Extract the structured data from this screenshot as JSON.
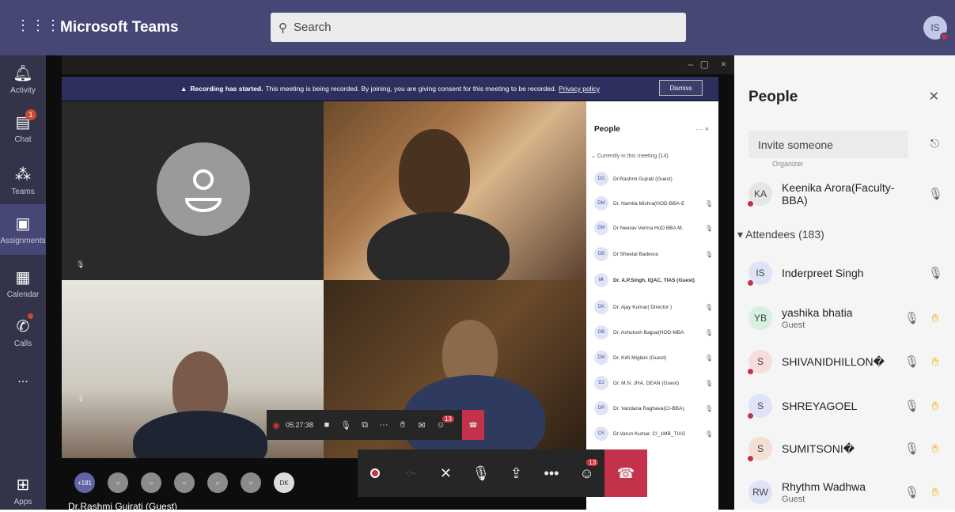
{
  "app": {
    "title": "Microsoft Teams",
    "user_initials": "IS"
  },
  "search": {
    "placeholder": "Search"
  },
  "rail": [
    {
      "label": "Activity",
      "icon": "bell-icon"
    },
    {
      "label": "Chat",
      "icon": "chat-icon",
      "badge": "1"
    },
    {
      "label": "Teams",
      "icon": "teams-icon"
    },
    {
      "label": "Assignments",
      "icon": "assignments-icon"
    },
    {
      "label": "Calendar",
      "icon": "calendar-icon"
    },
    {
      "label": "Calls",
      "icon": "phone-icon"
    },
    {
      "label": "...",
      "icon": "more-icon"
    },
    {
      "label": "Apps",
      "icon": "apps-icon"
    }
  ],
  "recording": {
    "bold": "Recording has started.",
    "text": "This meeting is being recorded. By joining, you are giving consent for this meeting to be recorded.",
    "link": "Privacy policy",
    "dismiss": "Dismiss"
  },
  "inner_people": {
    "title": "People",
    "section": "Currently in this meeting (14)",
    "rows": [
      {
        "initials": "DG",
        "name": "Dr.Rashmi Gujrati (Guest)"
      },
      {
        "initials": "DM",
        "name": "Dr. Namita Mishra(HOD-BBA-E"
      },
      {
        "initials": "DM",
        "name": "Dr Neerav Verma HoD BBA M."
      },
      {
        "initials": "DB",
        "name": "Dr Sheetal Badesra"
      },
      {
        "initials": "IA",
        "name": "Dr. A.P.Singh, IQAC, TIAS (Guest)"
      },
      {
        "initials": "DK",
        "name": "Dr. Ajay Kumar( Director )"
      },
      {
        "initials": "DB",
        "name": "Dr. Ashutosh Bajpai(HOD-MBA"
      },
      {
        "initials": "DM",
        "name": "Dr. Kirti Miglani (Guest)"
      },
      {
        "initials": "DJ",
        "name": "Dr. M.N. JHA, DEAN (Guest)"
      },
      {
        "initials": "DR",
        "name": "Dr. Vandana Raghava(CI-BBA)."
      },
      {
        "initials": "CK",
        "name": "Dr.Varun Kumar, CI_1MB_TIAS"
      }
    ]
  },
  "small_controls": {
    "timer": "05:27:38",
    "participants_badge": "13"
  },
  "big_controls": {
    "participants_badge": "13"
  },
  "strip": {
    "more_count": "+181",
    "dk": "DK",
    "name": "Dr.Rashmi Gujrati (Guest)"
  },
  "people": {
    "title": "People",
    "invite_placeholder": "Invite someone",
    "organizer_cut": "Organizer",
    "attendees_label": "Attendees (183)",
    "rows": [
      {
        "initials": "KA",
        "name": "Keenika Arora(Faculty-BBA)",
        "sub": "",
        "color": "#e5e5e5"
      },
      {
        "initials": "IS",
        "name": "Inderpreet Singh",
        "sub": "",
        "color": "#dfe3f7"
      },
      {
        "initials": "YB",
        "name": "yashika bhatia",
        "sub": "Guest",
        "color": "#d8f0e0"
      },
      {
        "initials": "S",
        "name": "SHIVANIDHILLON�",
        "sub": "",
        "color": "#f7dcdc"
      },
      {
        "initials": "S",
        "name": "SHREYAGOEL",
        "sub": "",
        "color": "#dfe3f7"
      },
      {
        "initials": "S",
        "name": "SUMITSONI�",
        "sub": "",
        "color": "#f3dfd4"
      },
      {
        "initials": "RW",
        "name": "Rhythm Wadhwa",
        "sub": "Guest",
        "color": "#dfe3f7"
      }
    ]
  }
}
